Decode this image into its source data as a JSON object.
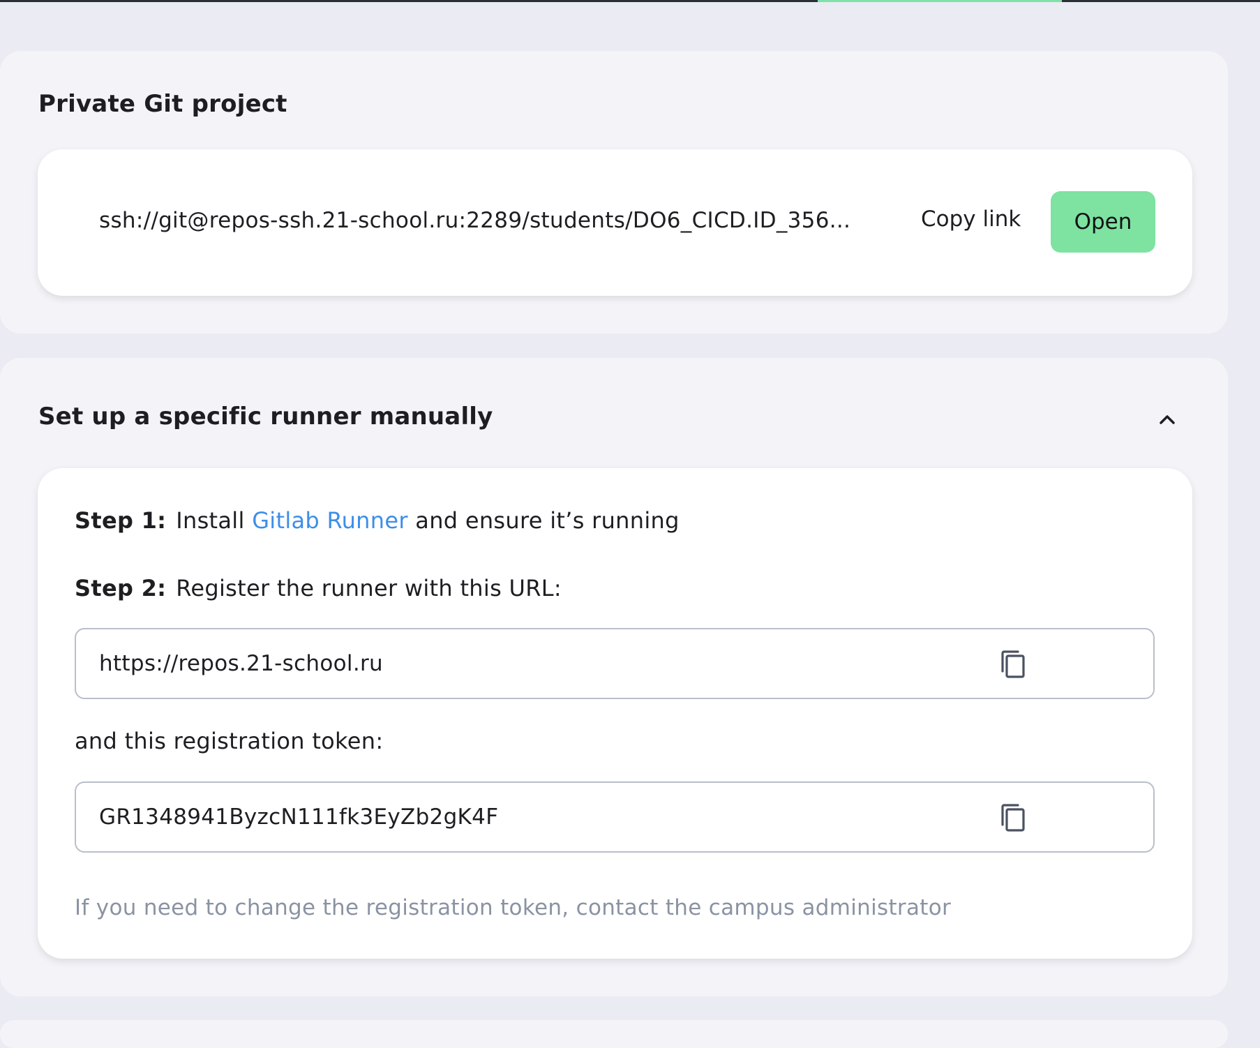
{
  "git_project": {
    "title": "Private Git project",
    "repo_link": "ssh://git@repos-ssh.21-school.ru:2289/students/DO6_CICD.ID_356...",
    "copy_link_label": "Copy link",
    "open_label": "Open"
  },
  "runner_setup": {
    "title": "Set up a specific runner manually",
    "expanded": true,
    "step1": {
      "label": "Step 1:",
      "text_before": "Install",
      "link_text": "Gitlab Runner",
      "text_after": "and ensure it’s running"
    },
    "step2": {
      "label": "Step 2:",
      "text": "Register the runner with this URL:"
    },
    "url_value": "https://repos.21-school.ru",
    "token_label": "and this registration token:",
    "token_value": "GR1348941ByzcN111fk3EyZb2gK4F",
    "hint": "If you need to change the registration token, contact the campus administrator"
  },
  "colors": {
    "accent_green": "#7ee2a0",
    "link_blue": "#3d8ee8",
    "hint_gray": "#8a93a3"
  },
  "icons": {
    "collapse": "chevron-up-icon",
    "copy": "copy-icon"
  }
}
